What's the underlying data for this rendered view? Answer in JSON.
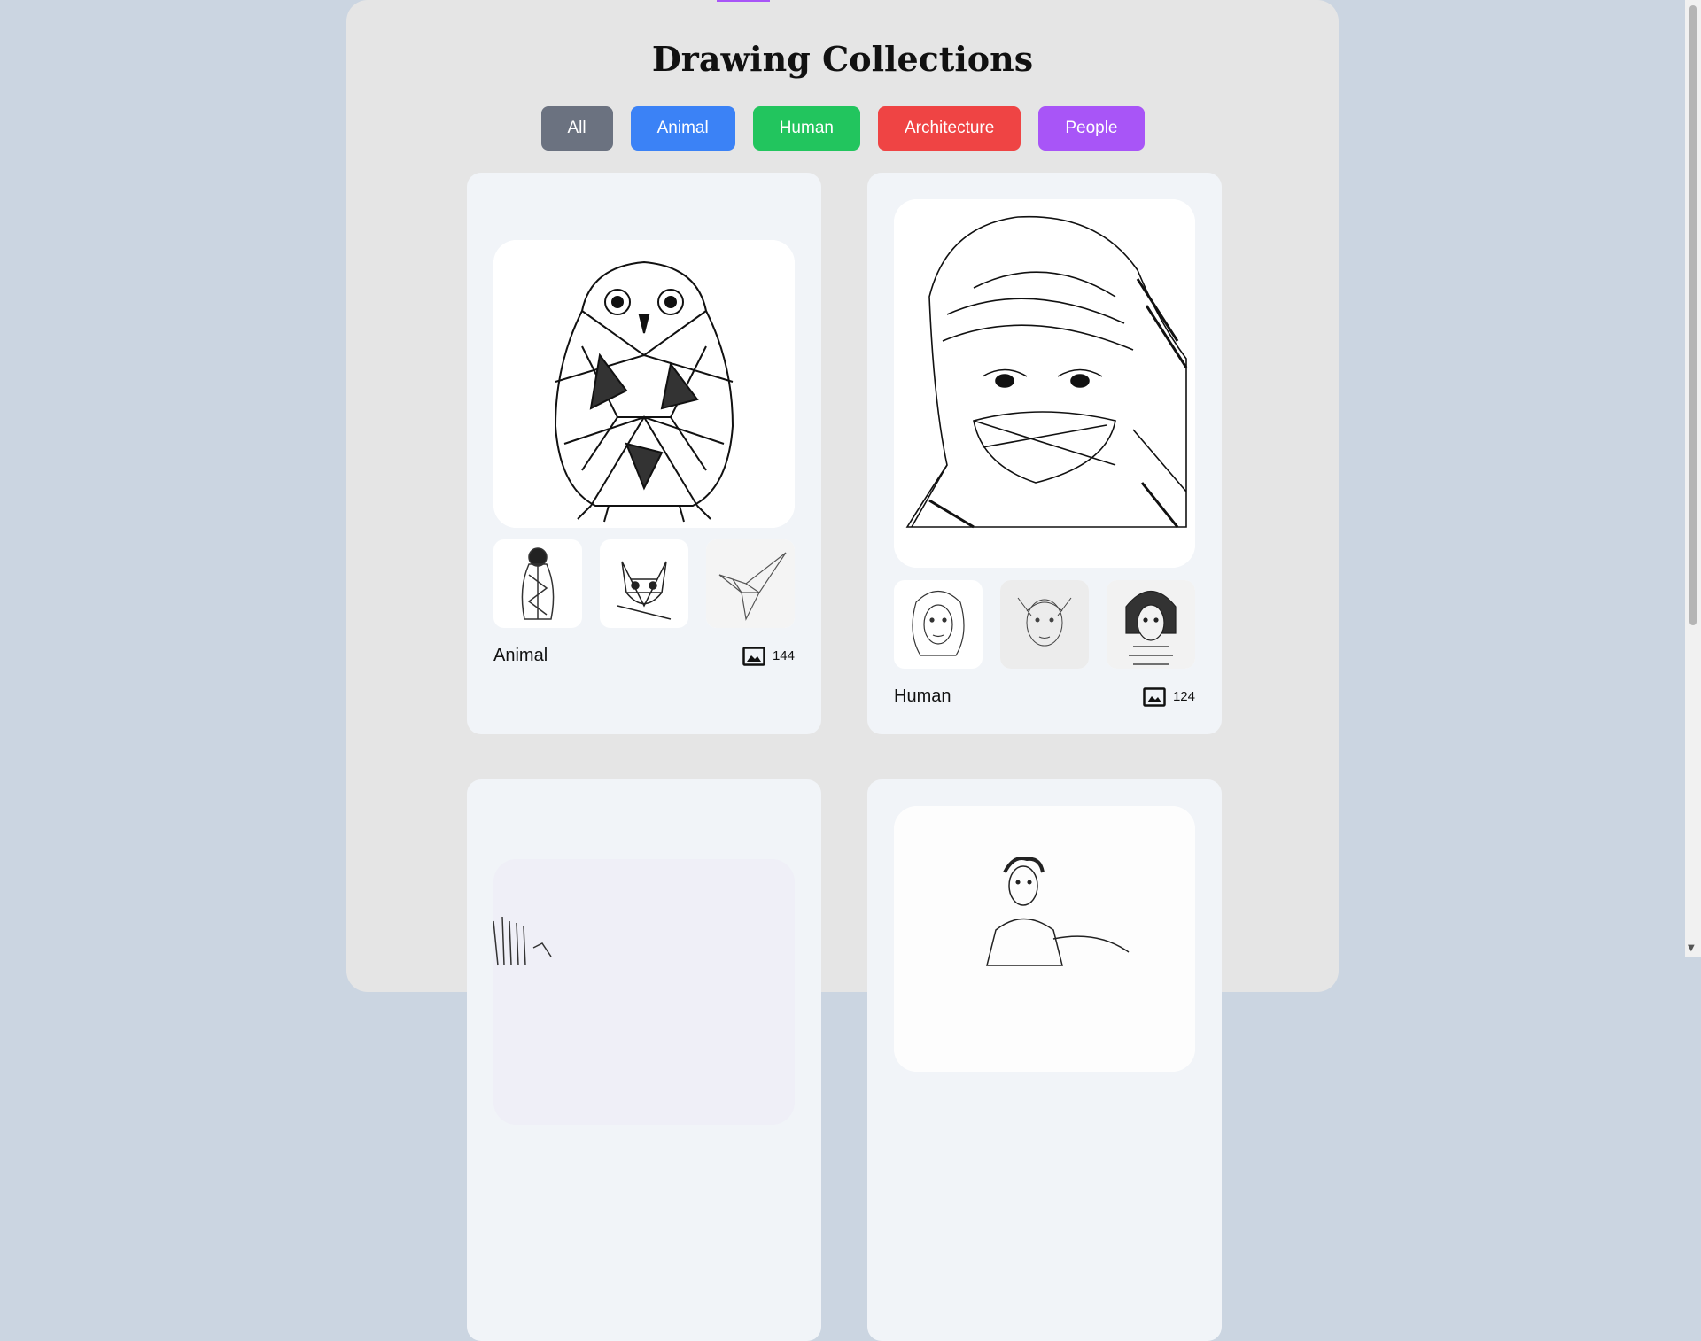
{
  "page": {
    "title": "Drawing Collections"
  },
  "filters": [
    {
      "label": "All",
      "color": "#6b7280"
    },
    {
      "label": "Animal",
      "color": "#3b82f6"
    },
    {
      "label": "Human",
      "color": "#22c55e"
    },
    {
      "label": "Architecture",
      "color": "#ef4444"
    },
    {
      "label": "People",
      "color": "#a855f7"
    }
  ],
  "cards": [
    {
      "name": "Animal",
      "count": "144",
      "icon": "image-icon"
    },
    {
      "name": "Human",
      "count": "124",
      "icon": "image-icon"
    }
  ],
  "colors": {
    "background": "#cbd5e1",
    "container": "#e5e5e5",
    "card": "#f1f4f8"
  }
}
